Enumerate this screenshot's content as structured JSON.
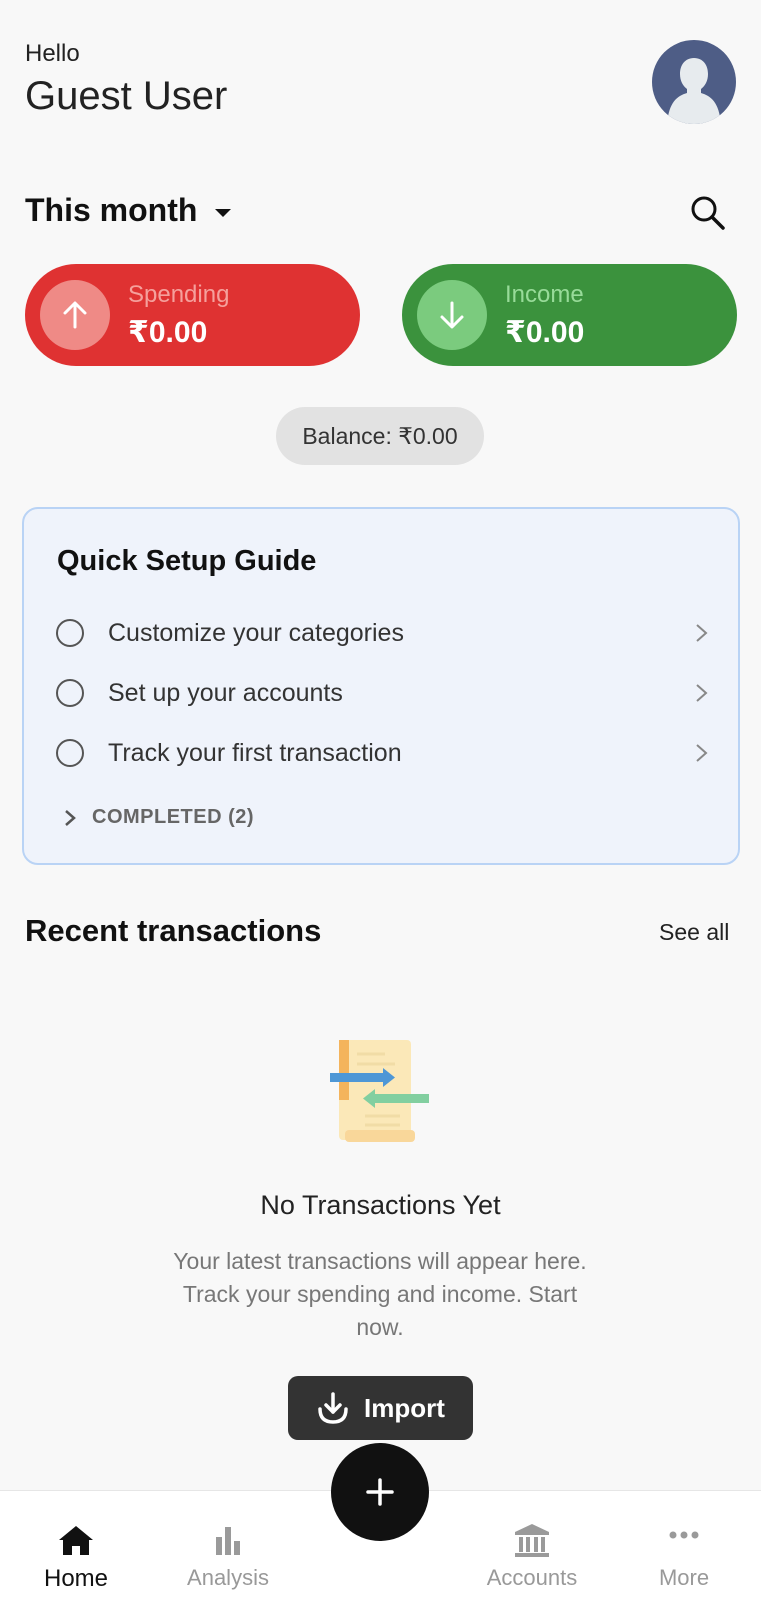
{
  "header": {
    "greeting": "Hello",
    "user_name": "Guest User",
    "avatar_icon": "user-avatar-icon"
  },
  "filter": {
    "period_label": "This month",
    "dropdown_icon": "caret-down-icon",
    "search_icon": "search-icon"
  },
  "summary": {
    "spending": {
      "label": "Spending",
      "amount": "₹0.00",
      "icon": "arrow-up-icon",
      "color": "#df3232"
    },
    "income": {
      "label": "Income",
      "amount": "₹0.00",
      "icon": "arrow-down-icon",
      "color": "#3b923d"
    },
    "balance": "Balance: ₹0.00"
  },
  "setup_guide": {
    "title": "Quick Setup Guide",
    "steps": [
      {
        "label": "Customize your categories",
        "done": false
      },
      {
        "label": "Set up your accounts",
        "done": false
      },
      {
        "label": "Track your first transaction",
        "done": false
      }
    ],
    "completed_label": "COMPLETED (2)"
  },
  "recent": {
    "title": "Recent transactions",
    "see_all": "See all",
    "empty_title": "No Transactions Yet",
    "empty_description": "Your latest transactions will appear here. Track your spending and income. Start now.",
    "import_label": "Import",
    "illustration_icon": "transactions-illustration-icon"
  },
  "nav": {
    "items": [
      {
        "label": "Home",
        "icon": "home-icon",
        "active": true
      },
      {
        "label": "Analysis",
        "icon": "bar-chart-icon",
        "active": false
      },
      {
        "label": "Accounts",
        "icon": "bank-icon",
        "active": false
      },
      {
        "label": "More",
        "icon": "more-dots-icon",
        "active": false
      }
    ],
    "fab_icon": "plus-icon"
  }
}
